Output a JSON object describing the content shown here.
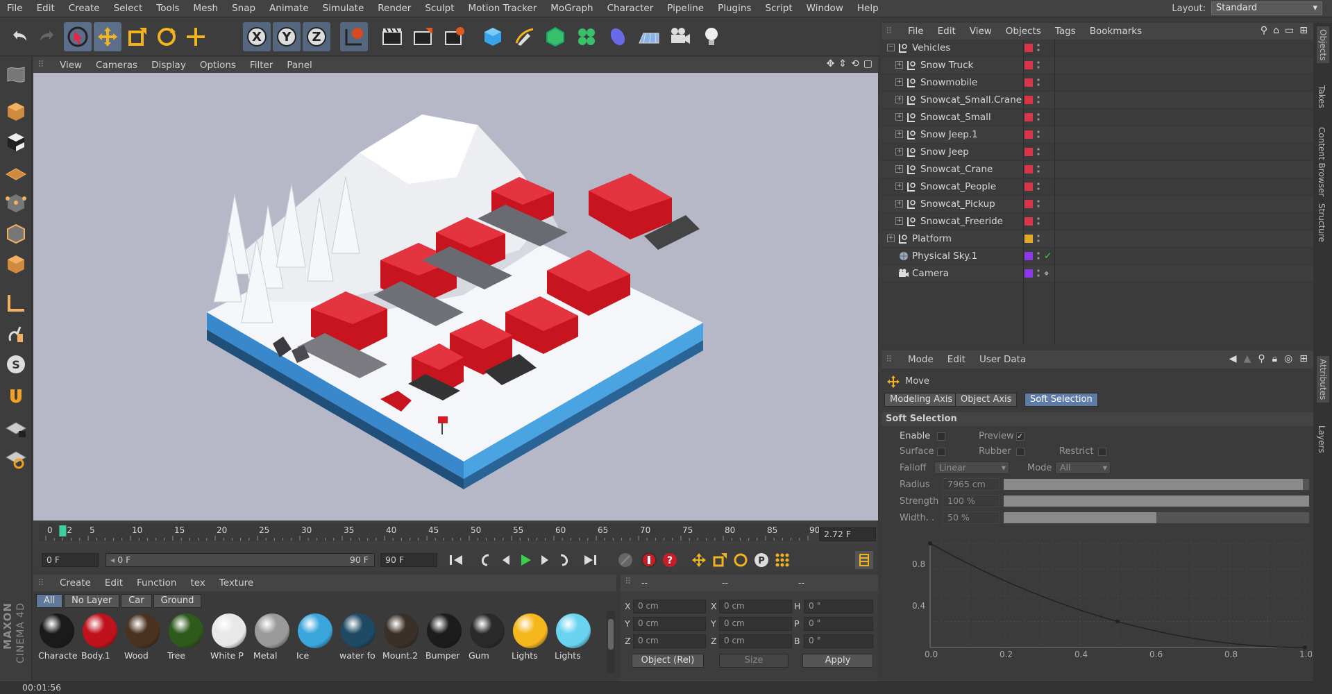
{
  "menubar": {
    "items": [
      "File",
      "Edit",
      "Create",
      "Select",
      "Tools",
      "Mesh",
      "Snap",
      "Animate",
      "Simulate",
      "Render",
      "Sculpt",
      "Motion Tracker",
      "MoGraph",
      "Character",
      "Pipeline",
      "Plugins",
      "Script",
      "Window",
      "Help"
    ],
    "layout_label": "Layout:",
    "layout_value": "Standard"
  },
  "toolbar": {
    "icons": [
      "undo-icon",
      "redo-icon",
      "select-icon",
      "move-icon",
      "scale-icon",
      "rotate-icon",
      "live-select-icon",
      "x-axis-icon",
      "y-axis-icon",
      "z-axis-icon",
      "world-coord-icon",
      "render-view-icon",
      "render-picture-icon",
      "render-settings-icon",
      "cube-icon",
      "pen-icon",
      "subdivision-icon",
      "cloner-icon",
      "deformer-icon",
      "floor-icon",
      "camera-icon",
      "light-icon"
    ],
    "axis_letters": [
      "X",
      "Y",
      "Z"
    ]
  },
  "viewport": {
    "menu": [
      "View",
      "Cameras",
      "Display",
      "Options",
      "Filter",
      "Panel"
    ]
  },
  "timeline": {
    "ticks": [
      "0",
      "5",
      "10",
      "15",
      "20",
      "25",
      "30",
      "35",
      "40",
      "45",
      "50",
      "55",
      "60",
      "65",
      "70",
      "75",
      "80",
      "85",
      "90"
    ],
    "current_marker": "2",
    "frame_readout": "2.72 F",
    "start_field": "0 F",
    "range_start": "0 F",
    "range_end": "90 F",
    "end_field": "90 F"
  },
  "materials": {
    "menu": [
      "Create",
      "Edit",
      "Function",
      "tex",
      "Texture"
    ],
    "tabs": [
      "All",
      "No Layer",
      "Car",
      "Ground"
    ],
    "items": [
      {
        "name": "Characte",
        "color": "#1a1a1a"
      },
      {
        "name": "Body.1",
        "color": "#c0121c"
      },
      {
        "name": "Wood",
        "color": "#4a3220"
      },
      {
        "name": "Tree",
        "color": "#2e5a1c"
      },
      {
        "name": "White P",
        "color": "#e8e8e8"
      },
      {
        "name": "Metal",
        "color": "#9a9a9a"
      },
      {
        "name": "Ice",
        "color": "#3aa6dc"
      },
      {
        "name": "water fo",
        "color": "#1e4a64"
      },
      {
        "name": "Mount.2",
        "color": "#3a3028"
      },
      {
        "name": "Bumper",
        "color": "#1c1c1c"
      },
      {
        "name": "Gum",
        "color": "#2a2a2a"
      },
      {
        "name": "Lights",
        "color": "#f5b71c"
      },
      {
        "name": "Lights",
        "color": "#6ad4f0"
      }
    ]
  },
  "coords": {
    "header": [
      "--",
      "--",
      "--"
    ],
    "rows": [
      {
        "a": "X",
        "av": "0 cm",
        "b": "X",
        "bv": "0 cm",
        "c": "H",
        "cv": "0 °"
      },
      {
        "a": "Y",
        "av": "0 cm",
        "b": "Y",
        "bv": "0 cm",
        "c": "P",
        "cv": "0 °"
      },
      {
        "a": "Z",
        "av": "0 cm",
        "b": "Z",
        "bv": "0 cm",
        "c": "B",
        "cv": "0 °"
      }
    ],
    "mode": "Object (Rel)",
    "size": "Size",
    "apply": "Apply"
  },
  "status": {
    "time": "00:01:56"
  },
  "brand": {
    "line1": "MAXON",
    "line2": "CINEMA 4D"
  },
  "object_manager": {
    "menu": [
      "File",
      "Edit",
      "View",
      "Objects",
      "Tags",
      "Bookmarks"
    ],
    "rows": [
      {
        "name": "Vehicles",
        "level": 0,
        "tag": "#d8344a"
      },
      {
        "name": "Snow Truck",
        "level": 1,
        "tag": "#d8344a"
      },
      {
        "name": "Snowmobile",
        "level": 1,
        "tag": "#d8344a"
      },
      {
        "name": "Snowcat_Small.Crane",
        "level": 1,
        "tag": "#d8344a"
      },
      {
        "name": "Snowcat_Small",
        "level": 1,
        "tag": "#d8344a"
      },
      {
        "name": "Snow Jeep.1",
        "level": 1,
        "tag": "#d8344a"
      },
      {
        "name": "Snow Jeep",
        "level": 1,
        "tag": "#d8344a"
      },
      {
        "name": "Snowcat_Crane",
        "level": 1,
        "tag": "#d8344a"
      },
      {
        "name": "Snowcat_People",
        "level": 1,
        "tag": "#d8344a"
      },
      {
        "name": "Snowcat_Pickup",
        "level": 1,
        "tag": "#d8344a"
      },
      {
        "name": "Snowcat_Freeride",
        "level": 1,
        "tag": "#d8344a"
      },
      {
        "name": "Platform",
        "level": 0,
        "tag": "#e0a828"
      },
      {
        "name": "Physical Sky.1",
        "level": 0,
        "tag": "#8a38e8"
      },
      {
        "name": "Camera",
        "level": 0,
        "tag": "#8a38e8"
      }
    ],
    "checkmark": "✓"
  },
  "side_tabs": [
    "Objects",
    "Takes",
    "Content Browser",
    "Structure",
    "Attributes",
    "Layers"
  ],
  "attributes": {
    "menu": [
      "Mode",
      "Edit",
      "User Data"
    ],
    "tool_name": "Move",
    "tabs": [
      "Modeling Axis",
      "Object Axis",
      "Soft Selection"
    ],
    "section": "Soft Selection",
    "enable": "Enable",
    "preview": "Preview",
    "surface": "Surface",
    "rubber": "Rubber",
    "restrict": "Restrict",
    "falloff": "Falloff",
    "falloff_value": "Linear",
    "mode": "Mode",
    "mode_value": "All",
    "radius": "Radius",
    "radius_value": "7965 cm",
    "radius_fraction": 0.98,
    "strength": "Strength",
    "strength_value": "100 %",
    "strength_fraction": 1.0,
    "width": "Width. .",
    "width_value": "50 %",
    "width_fraction": 0.5,
    "curve_x_ticks": [
      "0.0",
      "0.2",
      "0.4",
      "0.6",
      "0.8",
      "1.0"
    ],
    "curve_y_ticks": [
      "0.8",
      "0.4"
    ]
  }
}
